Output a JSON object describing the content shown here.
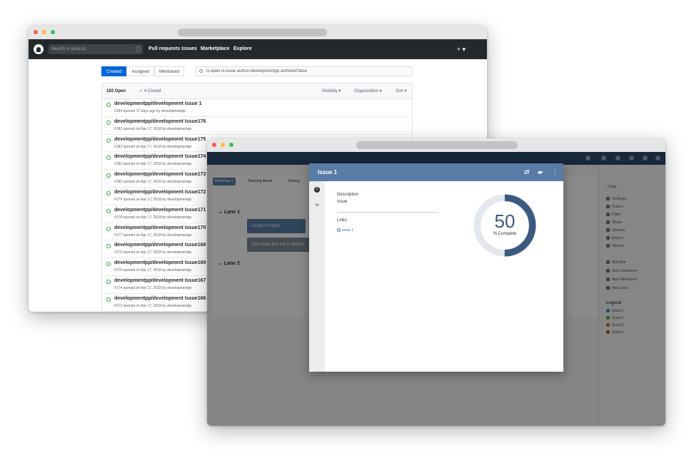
{
  "github": {
    "search_placeholder": "Search or jump to...",
    "search_shortcut": "/",
    "nav": [
      "Pull requests",
      "Issues",
      "Marketplace",
      "Explore"
    ],
    "plus": "+ ▾",
    "tabs": [
      "Created",
      "Assigned",
      "Mentioned"
    ],
    "filter_query": "is:open is:issue author:developmentpp archived:false",
    "open_count": "183 Open",
    "closed_count": "✓ 4 Closed",
    "filters": [
      "Visibility ▾",
      "Organization ▾",
      "Sort ▾"
    ],
    "issues": [
      {
        "title": "developmentpp/development  Issue 1",
        "meta": "#184 opened 17 days ago by developmentpp"
      },
      {
        "title": "developmentpp/development  Issue176",
        "meta": "#183 opened on Apr 17, 2018 by developmentpp"
      },
      {
        "title": "developmentpp/development  Issue175",
        "meta": "#182 opened on Apr 17, 2018 by developmentpp"
      },
      {
        "title": "developmentpp/development  Issue174",
        "meta": "#181 opened on Apr 17, 2018 by developmentpp"
      },
      {
        "title": "developmentpp/development  Issue173",
        "meta": "#180 opened on Apr 17, 2018 by developmentpp"
      },
      {
        "title": "developmentpp/development  Issue172",
        "meta": "#179 opened on Apr 17, 2018 by developmentpp"
      },
      {
        "title": "developmentpp/development  Issue171",
        "meta": "#178 opened on Apr 17, 2018 by developmentpp"
      },
      {
        "title": "developmentpp/development  Issue170",
        "meta": "#177 opened on Apr 17, 2018 by developmentpp"
      },
      {
        "title": "developmentpp/development  Issue168",
        "meta": "#175 opened on Apr 17, 2018 by developmentpp"
      },
      {
        "title": "developmentpp/development  Issue169",
        "meta": "#176 opened on Apr 17, 2018 by developmentpp"
      },
      {
        "title": "developmentpp/development  Issue167",
        "meta": "#174 opened on Apr 17, 2018 by developmentpp"
      },
      {
        "title": "developmentpp/development  Issue166",
        "meta": "#173 opened on Apr 17, 2018 by developmentpp"
      }
    ]
  },
  "roadmap": {
    "toolbar": [
      "Roadmap ▾",
      "Planning Board",
      "Parking"
    ],
    "lanes": [
      "Lane 1",
      "Lane 2"
    ],
    "bars": [
      "Cindy's Project",
      "Test issue find me in search"
    ],
    "sidebar": {
      "hide": "Hide",
      "menu": [
        "Settings",
        "Colors",
        "Filter",
        "Share",
        "Version",
        "Export",
        "History"
      ],
      "add": [
        "Add Bar",
        "Add Container",
        "Add Milestone",
        "Add Lane"
      ],
      "legend_title": "Legend",
      "legend": [
        "Goal 1",
        "Goal 2",
        "Goal 3",
        "Goal 4"
      ],
      "legend_colors": [
        "#5b6fb5",
        "#5aa05a",
        "#c46a3c",
        "#c44040"
      ]
    }
  },
  "modal": {
    "title": "Issue 1",
    "description_label": "Description",
    "description_value": "Issue",
    "links_label": "Links",
    "link_item": "Issue 1",
    "percent": 50,
    "percent_text": "50",
    "percent_label": "% Complete",
    "accent": "#587ca6"
  }
}
